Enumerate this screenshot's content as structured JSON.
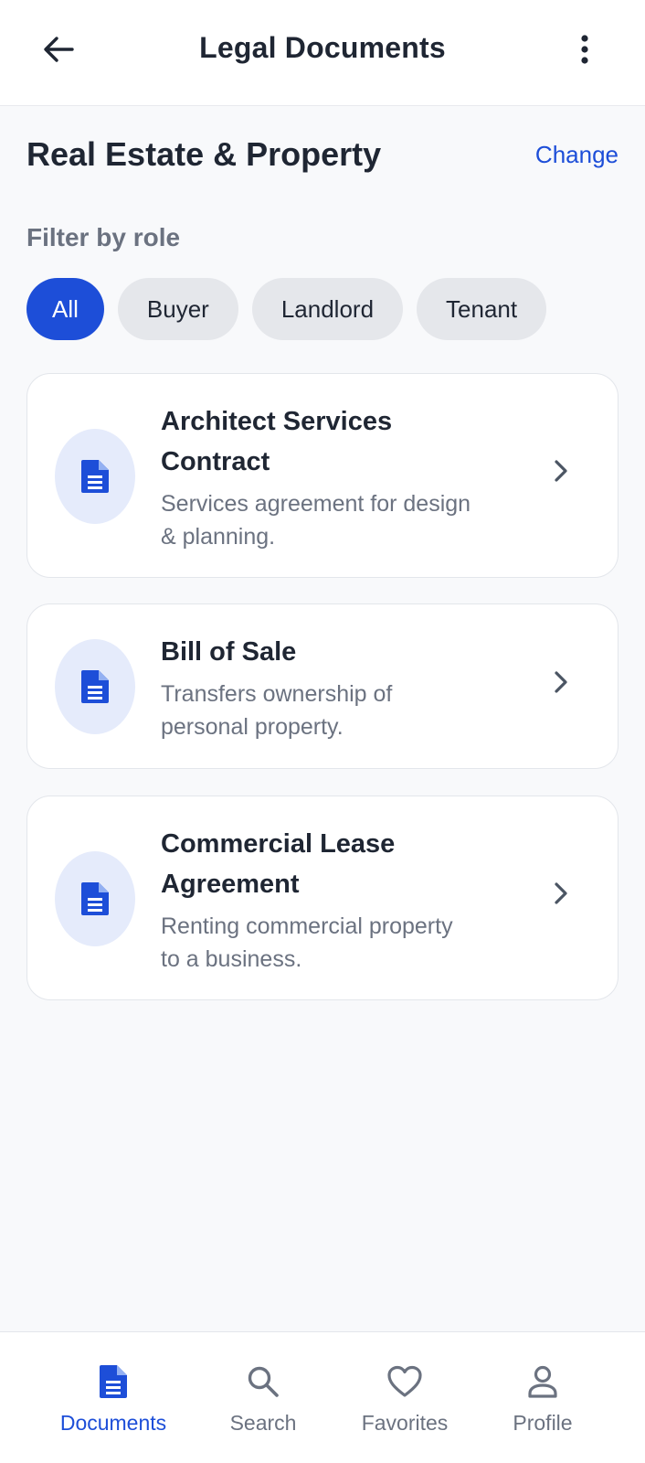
{
  "header": {
    "title": "Legal Documents"
  },
  "category": {
    "title": "Real Estate & Property",
    "change_label": "Change"
  },
  "filter": {
    "label": "Filter by role",
    "chips": [
      {
        "label": "All",
        "active": true
      },
      {
        "label": "Buyer",
        "active": false
      },
      {
        "label": "Landlord",
        "active": false
      },
      {
        "label": "Tenant",
        "active": false
      }
    ]
  },
  "documents": [
    {
      "title": "Architect Services Contract",
      "title_lines": [
        "Architect Services",
        "Contract"
      ],
      "description_lines": [
        "Services agreement for design",
        "& planning."
      ],
      "icon": "document-icon"
    },
    {
      "title": "Bill of Sale",
      "title_lines": [
        "Bill of Sale"
      ],
      "description_lines": [
        "Transfers ownership of",
        "personal property."
      ],
      "icon": "document-icon"
    },
    {
      "title": "Commercial Lease Agreement",
      "title_lines": [
        "Commercial Lease",
        "Agreement"
      ],
      "description_lines": [
        "Renting commercial property",
        "to a business."
      ],
      "icon": "document-icon"
    }
  ],
  "bottom_nav": [
    {
      "label": "Documents",
      "icon": "document-icon",
      "active": true
    },
    {
      "label": "Search",
      "icon": "search-icon",
      "active": false
    },
    {
      "label": "Favorites",
      "icon": "heart-icon",
      "active": false
    },
    {
      "label": "Profile",
      "icon": "person-icon",
      "active": false
    }
  ],
  "colors": {
    "accent": "#1d4ed8",
    "background": "#f8f9fb",
    "chip_inactive": "#e5e7eb",
    "icon_bubble": "#e5ebfb"
  }
}
